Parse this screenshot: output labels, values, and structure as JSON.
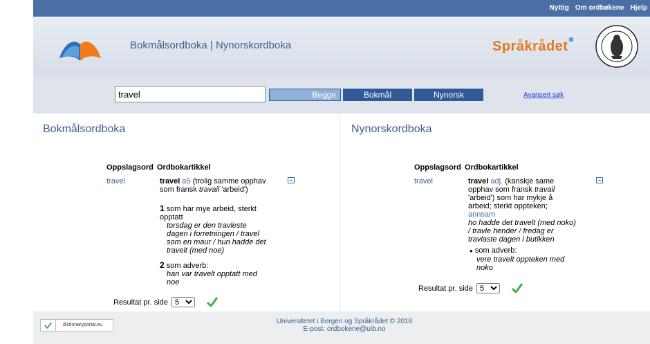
{
  "topnav": {
    "links": [
      "Nyttig",
      "Om ordbøkene",
      "Hjelp"
    ]
  },
  "header": {
    "title": "Bokmålsordboka | Nynorskordboka",
    "partner": "Språkrådet"
  },
  "search": {
    "value": "travel",
    "btn_begge": "Begge",
    "btn_bokmal": "Bokmål",
    "btn_nynorsk": "Nynorsk",
    "advanced": "Avansert søk"
  },
  "bokmal": {
    "title": "Bokmålsordboka",
    "col_headword": "Oppslagsord",
    "col_article": "Ordbokartikkel",
    "headword": "travel",
    "entry": {
      "hw": "travel",
      "gram": "a5",
      "etym_pre": "(trolig samme opphav som fransk ",
      "etym_word": "travail",
      "etym_post": " 'arbeid')"
    },
    "sense1": {
      "num": "1",
      "def": "som har mye arbeid, sterkt opptatt",
      "examples": "torsdag er den travleste dagen i forretningen / travel som en maur / hun hadde det travelt (med noe)"
    },
    "sense2": {
      "num": "2",
      "def": "som adverb:",
      "examples": "han var travelt opptatt med noe"
    },
    "perpage_label": "Resultat pr. side",
    "perpage_value": "5"
  },
  "nynorsk": {
    "title": "Nynorskordboka",
    "col_headword": "Oppslagsord",
    "col_article": "Ordbokartikkel",
    "headword": "travel",
    "entry": {
      "hw": "travel",
      "gram": "adj.",
      "etym_pre": "(kanskje same opphav som fransk ",
      "etym_word": "travail",
      "etym_post": " 'arbeid') som har mykje å arbeid; sterkt oppteken;",
      "link": "annsam"
    },
    "examples": "ho hadde det travelt (med noko) / travle hender / fredag er travlaste dagen i butikken",
    "sense": {
      "bullet": "●",
      "def": "som adverb:",
      "examples": "vere travelt oppteken med noko"
    },
    "perpage_label": "Resultat pr. side",
    "perpage_value": "5"
  },
  "footer": {
    "badge": "dictionaryportal.eu",
    "line1": "Universitetet i Bergen og Språkrådet © 2018",
    "line2": "E-post: ordbokene@uib.no"
  },
  "colors": {
    "topbar": "#4a6fa5",
    "accent": "#3b5e8c",
    "partner": "#e07a1f",
    "check": "#3cb043"
  }
}
